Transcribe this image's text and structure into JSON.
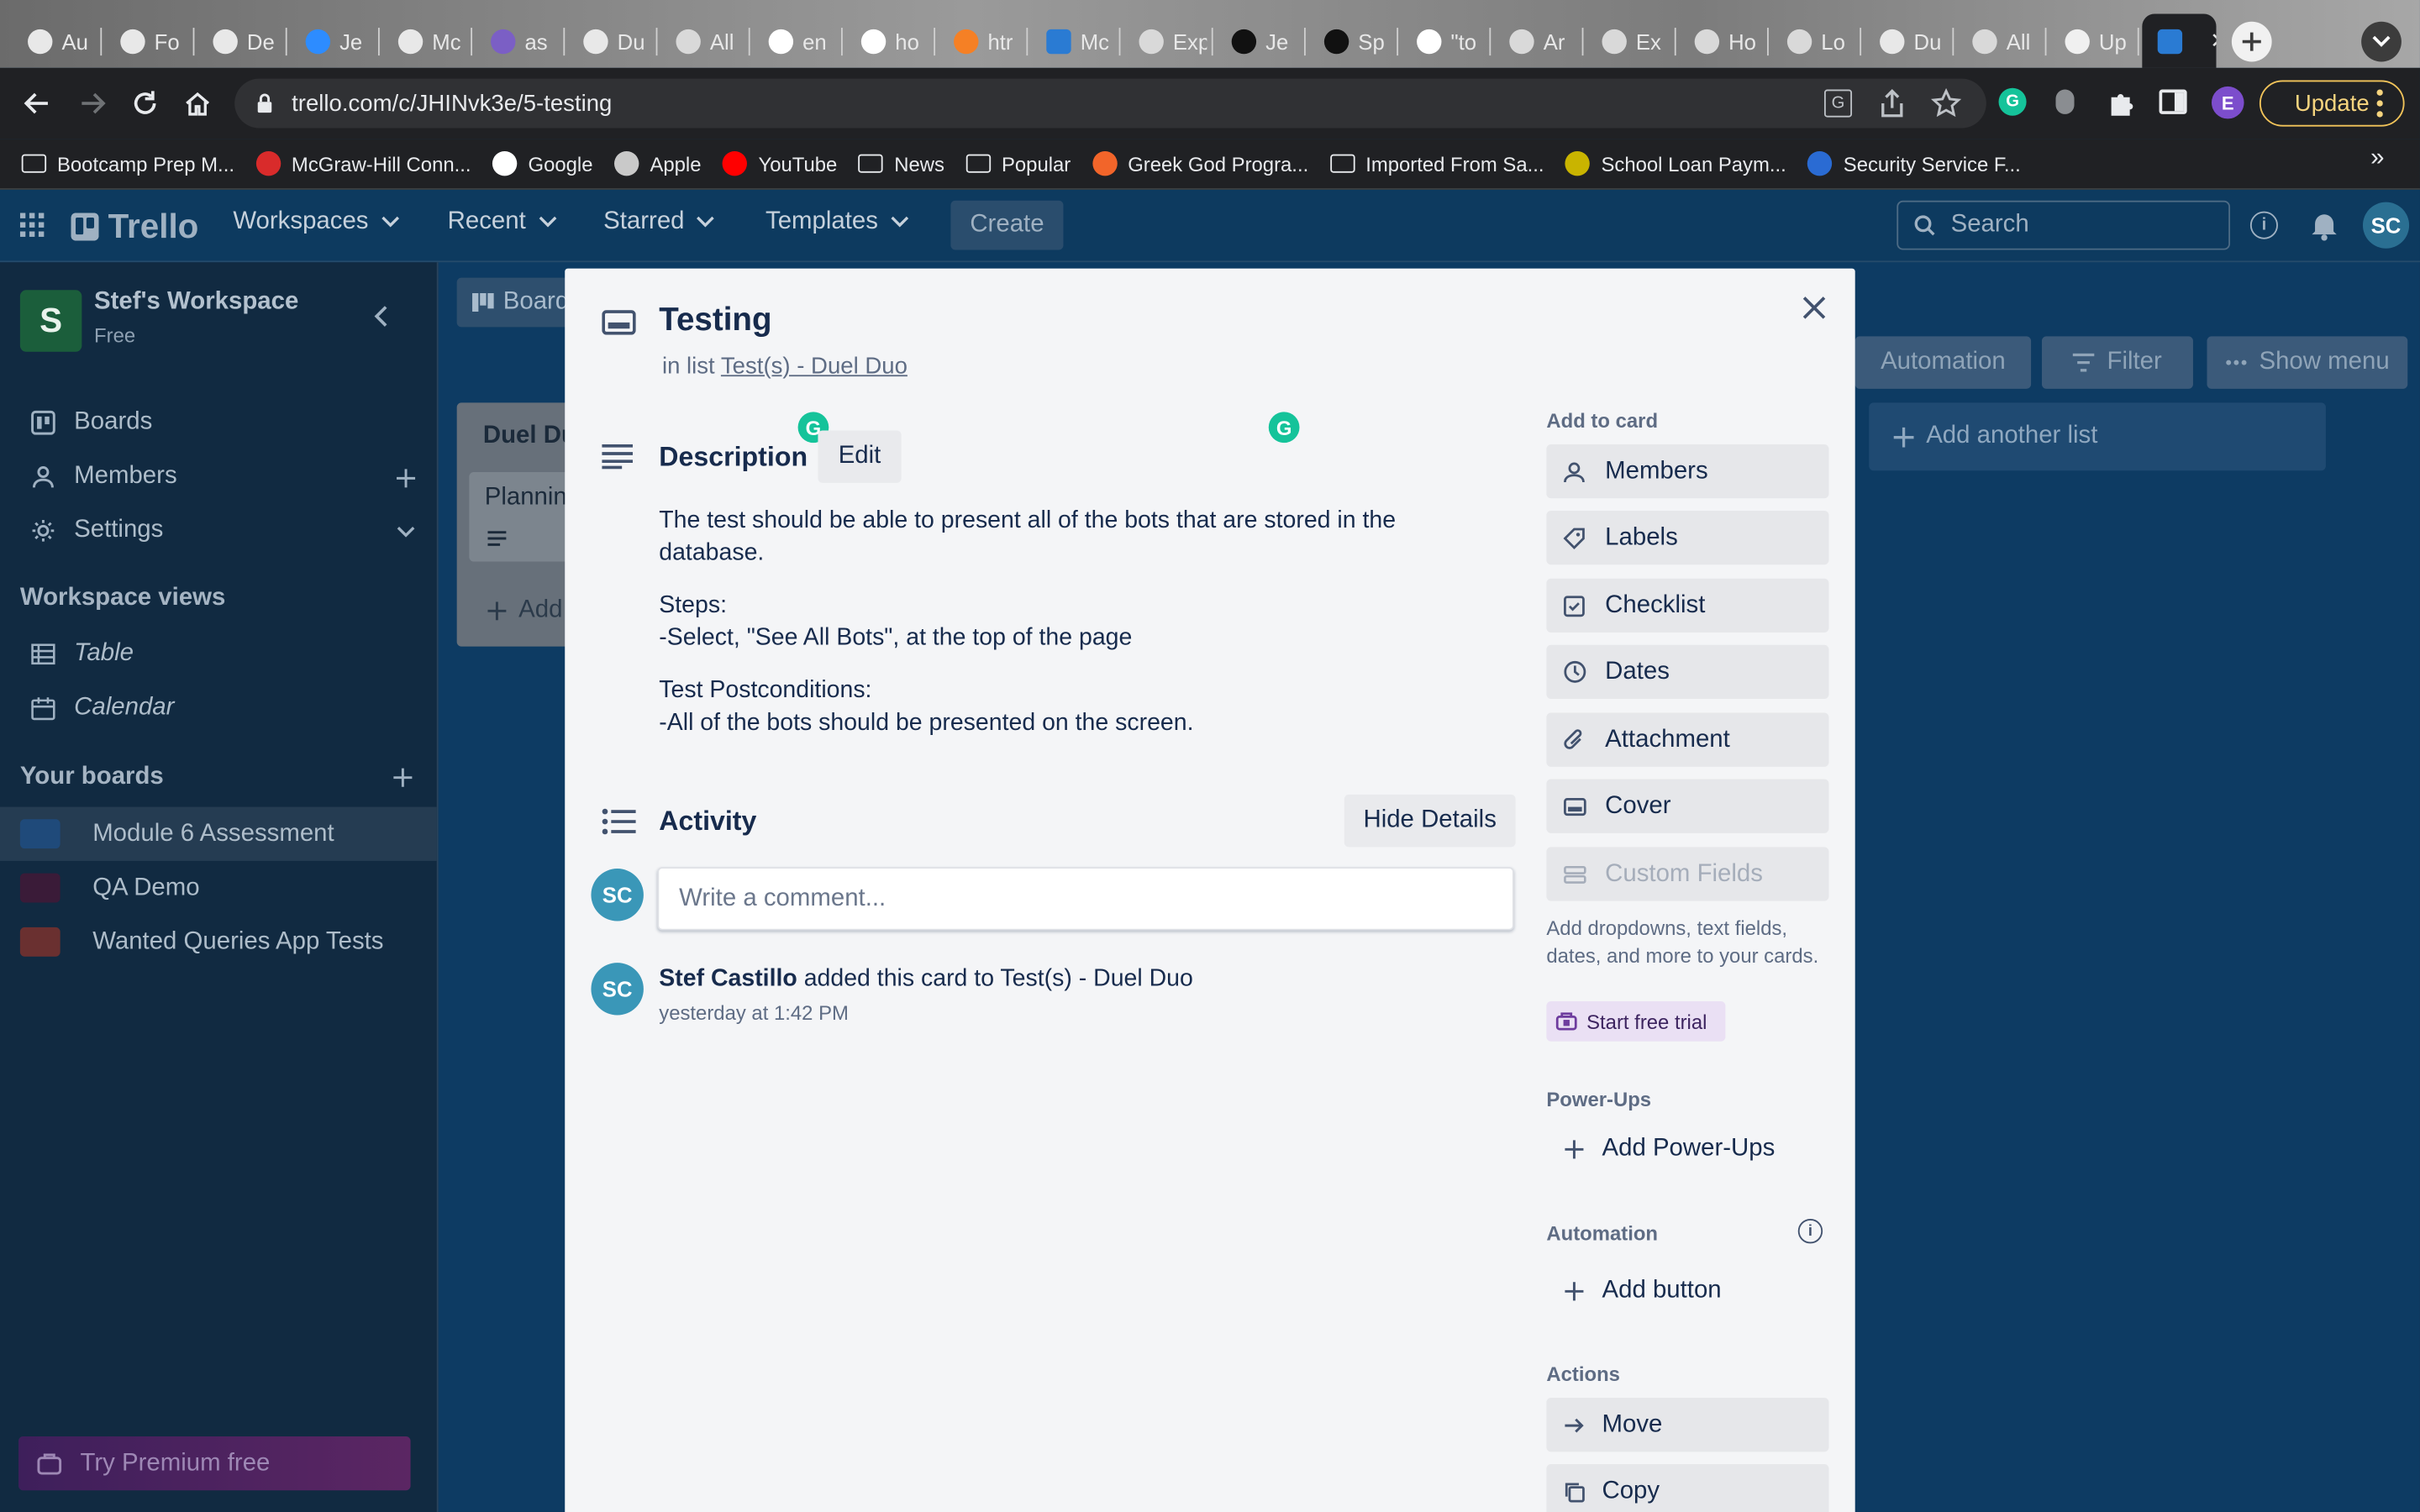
{
  "browser": {
    "tabs": [
      {
        "label": "Au",
        "icon": "globe-icon"
      },
      {
        "label": "Fo",
        "icon": "globe-icon"
      },
      {
        "label": "De",
        "icon": "globe-icon"
      },
      {
        "label": "Je",
        "icon": "zoom-icon"
      },
      {
        "label": "Mc",
        "icon": "globe-icon"
      },
      {
        "label": "as",
        "icon": "heroku-icon"
      },
      {
        "label": "Du",
        "icon": "globe-icon"
      },
      {
        "label": "All",
        "icon": "app-icon"
      },
      {
        "label": "en",
        "icon": "google-icon"
      },
      {
        "label": "ho",
        "icon": "google-icon"
      },
      {
        "label": "htr",
        "icon": "stackoverflow-icon"
      },
      {
        "label": "Mc",
        "icon": "trello-icon"
      },
      {
        "label": "Exp",
        "icon": "app-icon"
      },
      {
        "label": "Je",
        "icon": "medium-icon"
      },
      {
        "label": "Sp",
        "icon": "medium-icon"
      },
      {
        "label": "\"to",
        "icon": "google-icon"
      },
      {
        "label": "Ar",
        "icon": "app-icon"
      },
      {
        "label": "Ex",
        "icon": "app-icon"
      },
      {
        "label": "Ho",
        "icon": "app-icon"
      },
      {
        "label": "Lo",
        "icon": "app-icon"
      },
      {
        "label": "Du",
        "icon": "globe-icon"
      },
      {
        "label": "All",
        "icon": "app-icon"
      },
      {
        "label": "Up",
        "icon": "github-icon"
      },
      {
        "label": "",
        "icon": "trello-icon",
        "active": true
      }
    ],
    "url": "trello.com/c/JHINvk3e/5-testing",
    "update_label": "Update",
    "profile_initial": "E",
    "bookmarks": [
      {
        "label": "Bootcamp Prep M...",
        "icon": "folder-icon"
      },
      {
        "label": "McGraw-Hill Conn...",
        "icon": "mcgraw-icon"
      },
      {
        "label": "Google",
        "icon": "google-icon"
      },
      {
        "label": "Apple",
        "icon": "apple-icon"
      },
      {
        "label": "YouTube",
        "icon": "youtube-icon"
      },
      {
        "label": "News",
        "icon": "folder-icon"
      },
      {
        "label": "Popular",
        "icon": "folder-icon"
      },
      {
        "label": "Greek God Progra...",
        "icon": "kinobody-icon"
      },
      {
        "label": "Imported From Sa...",
        "icon": "folder-icon"
      },
      {
        "label": "School Loan Paym...",
        "icon": "nelnet-icon"
      },
      {
        "label": "Security Service F...",
        "icon": "ssfcu-icon"
      }
    ],
    "bookmarks_overflow": "»"
  },
  "trello": {
    "logo": "Trello",
    "nav": [
      "Workspaces",
      "Recent",
      "Starred",
      "Templates"
    ],
    "create": "Create",
    "search_placeholder": "Search",
    "user_initials": "SC",
    "workspace": {
      "initial": "S",
      "name": "Stef's Workspace",
      "plan": "Free"
    },
    "sidebar": {
      "items": [
        "Boards",
        "Members",
        "Settings"
      ],
      "views_title": "Workspace views",
      "views": [
        "Table",
        "Calendar"
      ],
      "boards_title": "Your boards",
      "boards": [
        {
          "name": "Module 6 Assessment",
          "color": "#1f4a7a",
          "selected": true
        },
        {
          "name": "QA Demo",
          "color": "#3a1b38"
        },
        {
          "name": "Wanted Queries App Tests",
          "color": "#6a3030"
        }
      ],
      "premium": "Try Premium free"
    },
    "board": {
      "board_btn": "Board",
      "list_title": "Duel Du",
      "card_title": "Plannin",
      "add_card": "Add",
      "automation": "Automation",
      "filter": "Filter",
      "show_menu": "Show menu",
      "add_list": "Add another list"
    }
  },
  "card": {
    "title": "Testing",
    "in_list_prefix": "in list",
    "list_name": "Test(s) - Duel Duo",
    "description_title": "Description",
    "edit": "Edit",
    "description_lines": [
      [
        "The test should be able to present all of the bots that are stored in the",
        "database."
      ],
      [
        "Steps:",
        "-Select, \"See All Bots\", at the top of the page"
      ],
      [
        "Test Postconditions:",
        "-All of the bots should be presented on the screen."
      ]
    ],
    "activity_title": "Activity",
    "hide_details": "Hide Details",
    "comment_placeholder": "Write a comment...",
    "activity": {
      "initials": "SC",
      "user": "Stef Castillo",
      "action": "added this card to Test(s) - Duel Duo",
      "time": "yesterday at 1:42 PM"
    },
    "add_to_card_title": "Add to card",
    "add_to_card": [
      {
        "label": "Members",
        "icon": "person-icon"
      },
      {
        "label": "Labels",
        "icon": "tag-icon"
      },
      {
        "label": "Checklist",
        "icon": "checklist-icon"
      },
      {
        "label": "Dates",
        "icon": "clock-icon"
      },
      {
        "label": "Attachment",
        "icon": "paperclip-icon"
      },
      {
        "label": "Cover",
        "icon": "cover-icon"
      },
      {
        "label": "Custom Fields",
        "icon": "custom-fields-icon",
        "disabled": true
      }
    ],
    "custom_fields_note": "Add dropdowns, text fields, dates, and more to your cards.",
    "start_trial": "Start free trial",
    "powerups_title": "Power-Ups",
    "add_powerups": "Add Power-Ups",
    "automation_title": "Automation",
    "add_button": "Add button",
    "actions_title": "Actions",
    "actions": [
      {
        "label": "Move",
        "icon": "arrow-right-icon"
      },
      {
        "label": "Copy",
        "icon": "copy-icon"
      }
    ]
  }
}
